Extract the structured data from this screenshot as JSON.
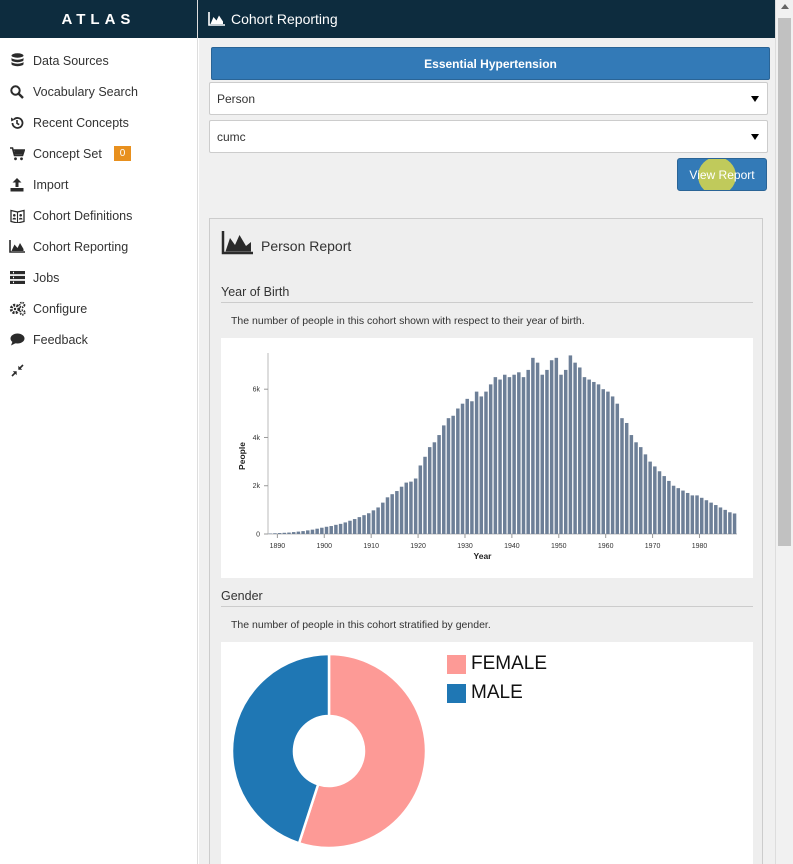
{
  "brand": "ATLAS",
  "sidebar": {
    "items": [
      {
        "label": "Data Sources",
        "icon": "database-icon"
      },
      {
        "label": "Vocabulary Search",
        "icon": "search-icon"
      },
      {
        "label": "Recent Concepts",
        "icon": "history-icon"
      },
      {
        "label": "Concept Set",
        "icon": "shopping-cart-icon",
        "badge": "0"
      },
      {
        "label": "Import",
        "icon": "upload-icon"
      },
      {
        "label": "Cohort Definitions",
        "icon": "users-book-icon"
      },
      {
        "label": "Cohort Reporting",
        "icon": "area-chart-icon"
      },
      {
        "label": "Jobs",
        "icon": "list-icon"
      },
      {
        "label": "Configure",
        "icon": "gears-icon"
      },
      {
        "label": "Feedback",
        "icon": "comment-icon"
      }
    ],
    "collapse_icon": "compress-icon"
  },
  "topbar": {
    "title": "Cohort Reporting",
    "icon": "area-chart-icon"
  },
  "main": {
    "cohort_button": "Essential Hypertension",
    "report_select": {
      "value": "Person"
    },
    "source_select": {
      "value": "cumc"
    },
    "view_report_button": "View Report",
    "report": {
      "title": "Person Report",
      "yob": {
        "title": "Year of Birth",
        "description": "The number of people in this cohort shown with respect to their year of birth."
      },
      "gender": {
        "title": "Gender",
        "description": "The number of people in this cohort stratified by gender."
      }
    }
  },
  "colors": {
    "topbar": "#0d2c3e",
    "button": "#337ab7",
    "badge": "#e8901e",
    "bar": "#6d7f97",
    "female": "#fd9a96",
    "male": "#1f77b4"
  },
  "chart_data": [
    {
      "type": "bar",
      "xlabel": "Year",
      "ylabel": "People",
      "xlim": [
        1888,
        1988
      ],
      "ylim": [
        0,
        7500
      ],
      "xticks": [
        "1890",
        "1900",
        "1910",
        "1920",
        "1930",
        "1940",
        "1950",
        "1960",
        "1970",
        "1980"
      ],
      "yticks": [
        "0",
        "2k",
        "4k",
        "6k"
      ],
      "x": [
        1888,
        1889,
        1890,
        1891,
        1892,
        1893,
        1894,
        1895,
        1896,
        1897,
        1898,
        1899,
        1900,
        1901,
        1902,
        1903,
        1904,
        1905,
        1906,
        1907,
        1908,
        1909,
        1910,
        1911,
        1912,
        1913,
        1914,
        1915,
        1916,
        1917,
        1918,
        1919,
        1920,
        1921,
        1922,
        1923,
        1924,
        1925,
        1926,
        1927,
        1928,
        1929,
        1930,
        1931,
        1932,
        1933,
        1934,
        1935,
        1936,
        1937,
        1938,
        1939,
        1940,
        1941,
        1942,
        1943,
        1944,
        1945,
        1946,
        1947,
        1948,
        1949,
        1950,
        1951,
        1952,
        1953,
        1954,
        1955,
        1956,
        1957,
        1958,
        1959,
        1960,
        1961,
        1962,
        1963,
        1964,
        1965,
        1966,
        1967,
        1968,
        1969,
        1970,
        1971,
        1972,
        1973,
        1974,
        1975,
        1976,
        1977,
        1978,
        1979,
        1980,
        1981,
        1982,
        1983,
        1984,
        1985,
        1986,
        1987
      ],
      "values": [
        20,
        30,
        40,
        50,
        60,
        80,
        100,
        120,
        150,
        180,
        220,
        260,
        300,
        330,
        380,
        420,
        480,
        550,
        620,
        700,
        780,
        860,
        980,
        1100,
        1300,
        1520,
        1650,
        1780,
        1960,
        2130,
        2170,
        2300,
        2840,
        3200,
        3600,
        3800,
        4100,
        4500,
        4800,
        4900,
        5200,
        5400,
        5600,
        5500,
        5900,
        5700,
        5900,
        6200,
        6500,
        6400,
        6600,
        6500,
        6600,
        6700,
        6500,
        6800,
        7300,
        7100,
        6600,
        6800,
        7200,
        7300,
        6600,
        6800,
        7400,
        7100,
        6900,
        6500,
        6400,
        6300,
        6200,
        6000,
        5900,
        5700,
        5400,
        4800,
        4600,
        4100,
        3800,
        3600,
        3300,
        3000,
        2800,
        2600,
        2400,
        2200,
        2000,
        1900,
        1800,
        1700,
        1600,
        1600,
        1500,
        1400,
        1300,
        1200,
        1100,
        1000,
        900,
        850
      ]
    },
    {
      "type": "pie",
      "categories": [
        "FEMALE",
        "MALE"
      ],
      "values": [
        0.55,
        0.45
      ]
    }
  ]
}
